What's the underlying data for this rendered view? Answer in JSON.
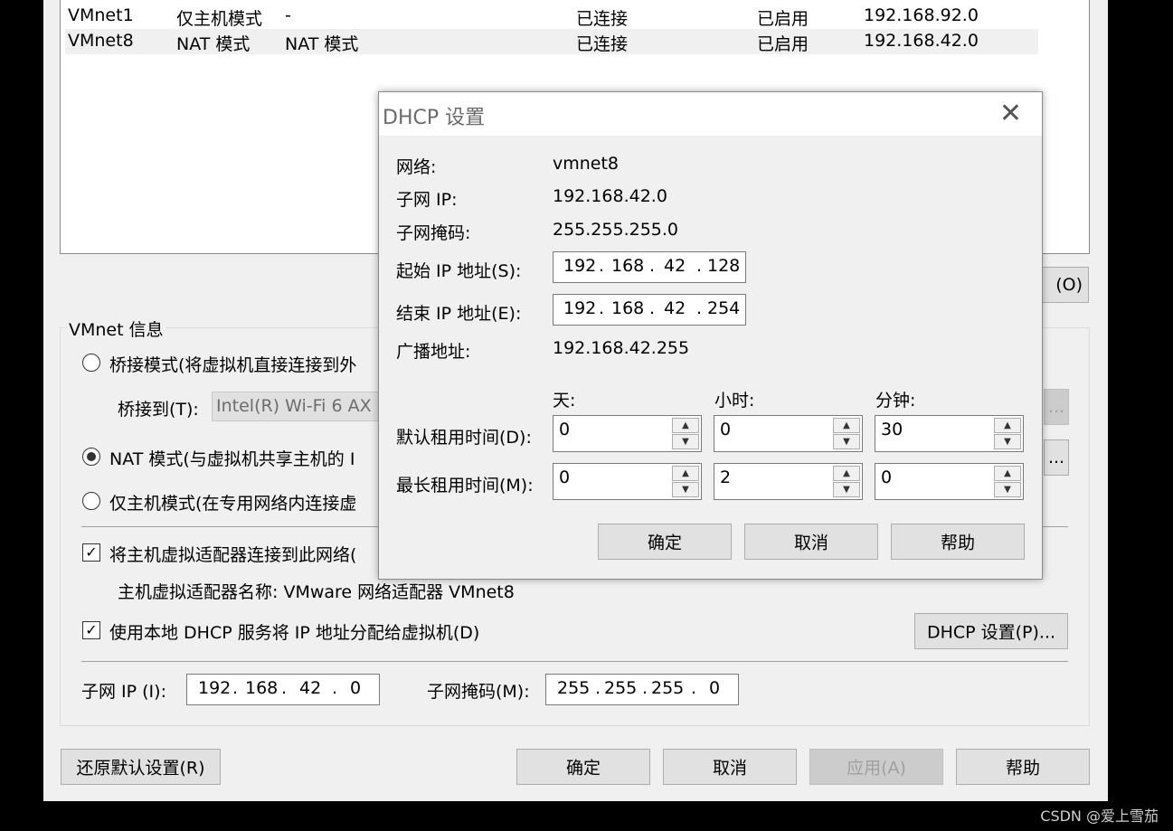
{
  "networks": {
    "rows": [
      {
        "name": "VMnet1",
        "type": "仅主机模式",
        "external": "-",
        "host": "已连接",
        "dhcp": "已启用",
        "subnet": "192.168.92.0"
      },
      {
        "name": "VMnet8",
        "type": "NAT 模式",
        "external": "NAT 模式",
        "host": "已连接",
        "dhcp": "已启用",
        "subnet": "192.168.42.0"
      }
    ],
    "hidden_button_suffix": "(O)"
  },
  "vmnet_info": {
    "group_title": "VMnet 信息",
    "bridged_label": "桥接模式(将虚拟机直接连接到外",
    "bridge_to_label": "桥接到(T):",
    "bridge_to_value": "Intel(R) Wi-Fi 6 AX",
    "nat_label": "NAT 模式(与虚拟机共享主机的 I",
    "hostonly_label": "仅主机模式(在专用网络内连接虚",
    "connect_adapter_label": "将主机虚拟适配器连接到此网络(",
    "adapter_name_label": "主机虚拟适配器名称: VMware 网络适配器 VMnet8",
    "use_dhcp_label": "使用本地 DHCP 服务将 IP 地址分配给虚拟机(D)",
    "dhcp_settings_button": "DHCP 设置(P)...",
    "partial_button_dots": "...",
    "subnet_ip_label": "子网 IP (I):",
    "subnet_ip": [
      "192",
      "168",
      "42",
      "0"
    ],
    "subnet_mask_label": "子网掩码(M):",
    "subnet_mask": [
      "255",
      "255",
      "255",
      "0"
    ]
  },
  "bottom_buttons": {
    "restore": "还原默认设置(R)",
    "ok": "确定",
    "cancel": "取消",
    "apply": "应用(A)",
    "help": "帮助"
  },
  "dhcp_dialog": {
    "title": "DHCP 设置",
    "network_label": "网络:",
    "network_value": "vmnet8",
    "subnet_ip_label": "子网 IP:",
    "subnet_ip_value": "192.168.42.0",
    "subnet_mask_label": "子网掩码:",
    "subnet_mask_value": "255.255.255.0",
    "start_ip_label": "起始 IP 地址(S):",
    "start_ip": [
      "192",
      "168",
      "42",
      "128"
    ],
    "end_ip_label": "结束 IP 地址(E):",
    "end_ip": [
      "192",
      "168",
      "42",
      "254"
    ],
    "broadcast_label": "广播地址:",
    "broadcast_value": "192.168.42.255",
    "col_days": "天:",
    "col_hours": "小时:",
    "col_minutes": "分钟:",
    "default_lease_label": "默认租用时间(D):",
    "default_lease": {
      "days": "0",
      "hours": "0",
      "minutes": "30"
    },
    "max_lease_label": "最长租用时间(M):",
    "max_lease": {
      "days": "0",
      "hours": "2",
      "minutes": "0"
    },
    "ok": "确定",
    "cancel": "取消",
    "help": "帮助"
  },
  "watermark": "CSDN @爱上雪茄"
}
